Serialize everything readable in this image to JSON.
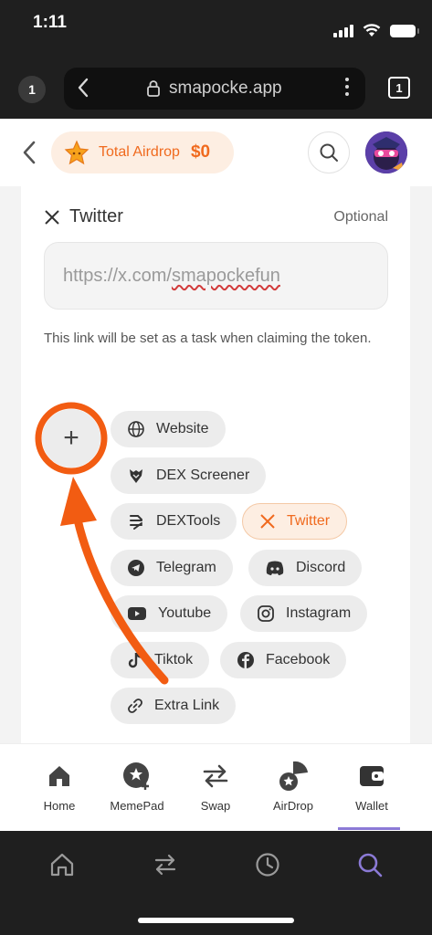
{
  "status_bar": {
    "time": "1:11"
  },
  "browser": {
    "tab_badge": "1",
    "url": "smapocke.app",
    "tab_count": "1"
  },
  "header": {
    "airdrop_label": "Total Airdrop",
    "airdrop_value": "$0"
  },
  "twitter_section": {
    "title": "Twitter",
    "optional": "Optional",
    "url_prefix": "https://x.com/",
    "url_handle": "smapockefun",
    "helper": "This link will be set as a task when claiming the token."
  },
  "add_button": {
    "label": "+"
  },
  "link_chips": [
    {
      "label": "Website",
      "icon": "globe-icon"
    },
    {
      "label": "DEX Screener",
      "icon": "dexscreener-icon"
    },
    {
      "label": "DEXTools",
      "icon": "dextools-icon"
    },
    {
      "label": "Twitter",
      "icon": "x-icon",
      "active": true
    },
    {
      "label": "Telegram",
      "icon": "telegram-icon"
    },
    {
      "label": "Discord",
      "icon": "discord-icon"
    },
    {
      "label": "Youtube",
      "icon": "youtube-icon"
    },
    {
      "label": "Instagram",
      "icon": "instagram-icon"
    },
    {
      "label": "Tiktok",
      "icon": "tiktok-icon"
    },
    {
      "label": "Facebook",
      "icon": "facebook-icon"
    },
    {
      "label": "Extra Link",
      "icon": "link-icon"
    }
  ],
  "bottom_nav": [
    {
      "label": "Home",
      "icon": "home-icon"
    },
    {
      "label": "MemePad",
      "icon": "memepad-icon"
    },
    {
      "label": "Swap",
      "icon": "swap-icon"
    },
    {
      "label": "AirDrop",
      "icon": "airdrop-icon"
    },
    {
      "label": "Wallet",
      "icon": "wallet-icon",
      "active": true
    }
  ],
  "colors": {
    "accent": "#f06a1e",
    "accent_bg": "#fdeee2",
    "annotation": "#f25c12",
    "nav_active": "#8b7ad6"
  }
}
